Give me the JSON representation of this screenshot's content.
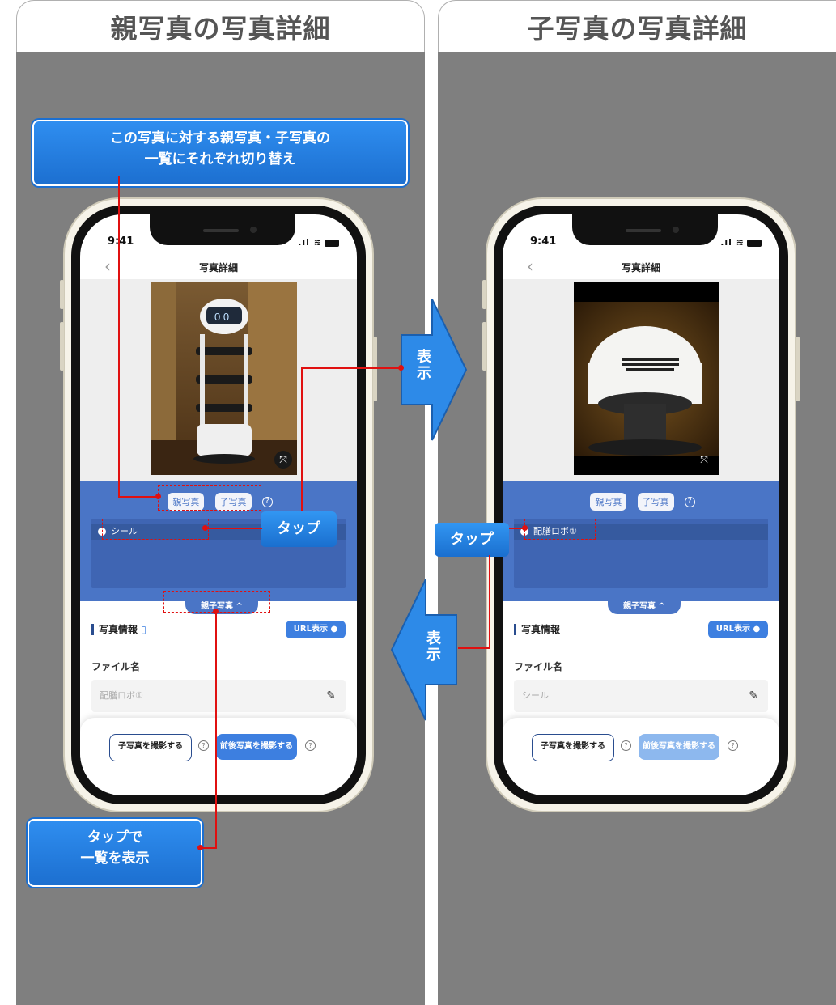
{
  "left_panel": {
    "heading": "親写真の写真詳細",
    "callout_top": {
      "line1": "この写真に対する親写真・子写真の",
      "line2": "一覧にそれぞれ切り替え"
    },
    "tap_badge": "タップ",
    "callout_bottom": {
      "line1": "タップで",
      "line2": "一覧を表示"
    },
    "phone": {
      "time": "9:41",
      "nav_title": "写真詳細",
      "chips": [
        "親写真",
        "子写真"
      ],
      "list_items": [
        "シール"
      ],
      "toggle_label": "親子写真 ^",
      "info_title": "写真情報",
      "url_button": "URL表示",
      "file_label": "ファイル名",
      "file_value": "配膳ロボ①",
      "btn_child": "子写真を撮影する",
      "btn_before_after": "前後写真を撮影する"
    }
  },
  "right_panel": {
    "heading": "子写真の写真詳細",
    "tap_badge": "タップ",
    "phone": {
      "time": "9:41",
      "nav_title": "写真詳細",
      "chips": [
        "親写真",
        "子写真"
      ],
      "list_items": [
        "配膳ロボ①"
      ],
      "toggle_label": "親子写真 ^",
      "info_title": "写真情報",
      "url_button": "URL表示",
      "file_label": "ファイル名",
      "file_value": "シール",
      "btn_child": "子写真を撮影する",
      "btn_before_after": "前後写真を撮影する"
    }
  },
  "arrows": {
    "right_arrow_label": [
      "表",
      "示"
    ],
    "left_arrow_label": [
      "表",
      "示"
    ]
  },
  "colors": {
    "accent": "#4a75c6",
    "callout": "#1c6fd0",
    "annotation": "#e01010",
    "panel_bg": "#7f7f7f"
  }
}
